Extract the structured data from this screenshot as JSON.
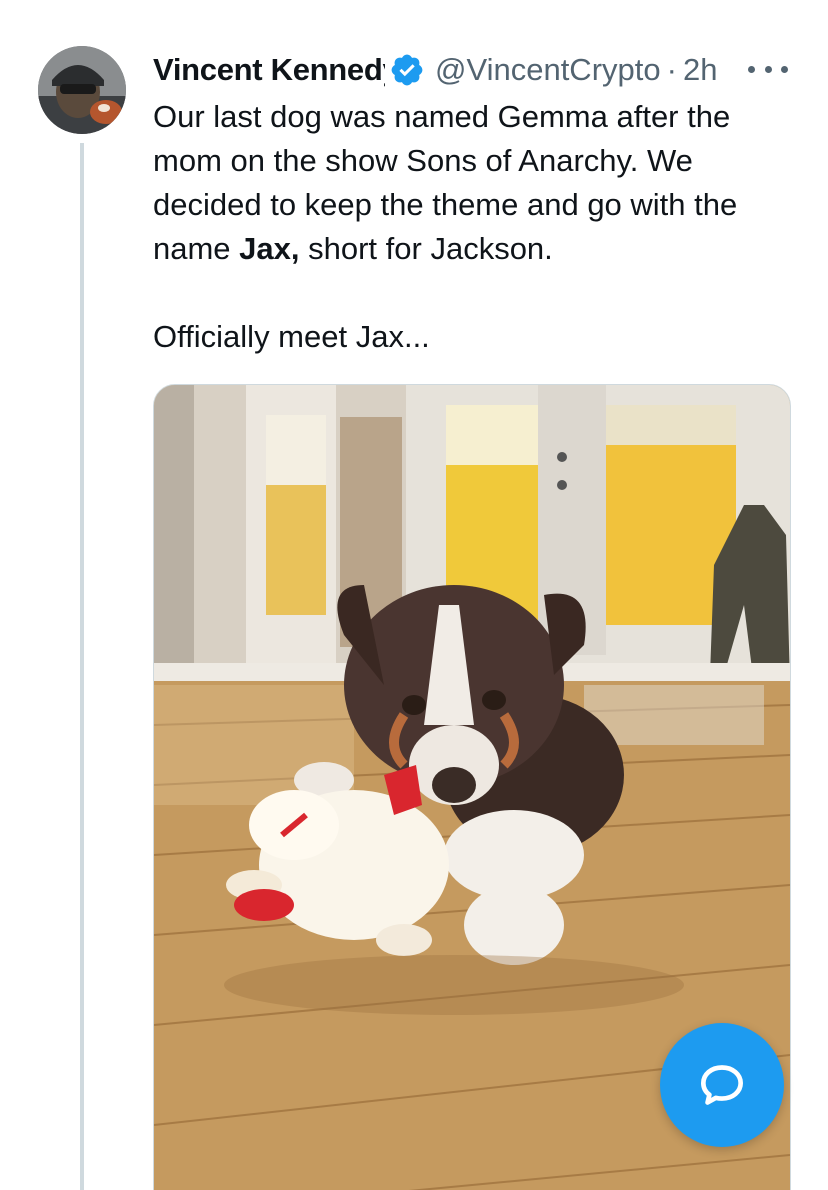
{
  "tweet": {
    "author_name": "Vincent Kennedy",
    "handle": "@VincentCrypto",
    "separator": "·",
    "time": "2h",
    "text_part1": "Our last dog was named Gemma after the mom on the show Sons of Anarchy. We decided to keep the theme and go with the name ",
    "text_bold": "Jax,",
    "text_part2": " short for Jackson.",
    "text_line2": "Officially meet Jax...",
    "verified": true
  },
  "icons": {
    "verified": "verified-badge-icon",
    "more": "more-options-icon",
    "compose": "chat-bubble-icon"
  },
  "colors": {
    "accent": "#1d9bf0",
    "secondary_text": "#536471",
    "thread_line": "#cfd9de"
  }
}
